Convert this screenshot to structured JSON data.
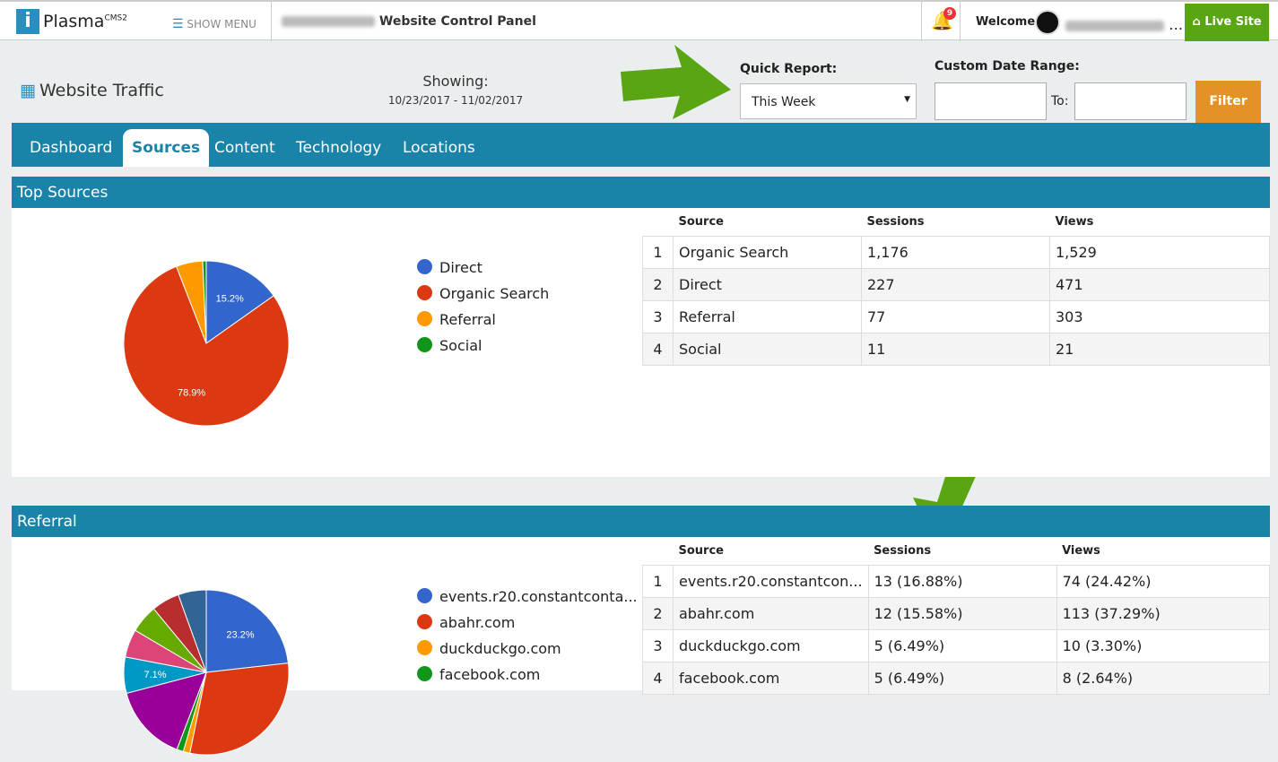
{
  "header": {
    "logo": "Plasma",
    "logo_sup": "CMS2",
    "menu_label": "SHOW MENU",
    "panel_title": "Website Control Panel",
    "notifications": "9",
    "welcome": "Welcome",
    "live_site": "Live Site"
  },
  "toolbar": {
    "page_title": "Website Traffic",
    "showing_label": "Showing:",
    "showing_range": "10/23/2017 - 11/02/2017",
    "quick_report_label": "Quick Report:",
    "quick_report_value": "This Week",
    "custom_range_label": "Custom Date Range:",
    "to_label": "To:",
    "filter": "Filter"
  },
  "tabs": [
    {
      "label": "Dashboard"
    },
    {
      "label": "Sources",
      "active": true
    },
    {
      "label": "Content"
    },
    {
      "label": "Technology"
    },
    {
      "label": "Locations"
    }
  ],
  "top_sources": {
    "title": "Top Sources",
    "columns": [
      "Source",
      "Sessions",
      "Views"
    ],
    "rows": [
      [
        "1",
        "Organic Search",
        "1,176",
        "1,529"
      ],
      [
        "2",
        "Direct",
        "227",
        "471"
      ],
      [
        "3",
        "Referral",
        "77",
        "303"
      ],
      [
        "4",
        "Social",
        "11",
        "21"
      ]
    ]
  },
  "referral": {
    "title": "Referral",
    "columns": [
      "Source",
      "Sessions",
      "Views"
    ],
    "rows": [
      [
        "1",
        "events.r20.constantcon...",
        "13 (16.88%)",
        "74 (24.42%)"
      ],
      [
        "2",
        "abahr.com",
        "12 (15.58%)",
        "113 (37.29%)"
      ],
      [
        "3",
        "duckduckgo.com",
        "5 (6.49%)",
        "10 (3.30%)"
      ],
      [
        "4",
        "facebook.com",
        "5 (6.49%)",
        "8 (2.64%)"
      ]
    ]
  },
  "chart_data": [
    {
      "type": "pie",
      "legend": [
        "Direct",
        "Organic Search",
        "Referral",
        "Social"
      ],
      "values": [
        15.2,
        78.9,
        5.2,
        0.7
      ],
      "labels": [
        "15.2%",
        "78.9%",
        "",
        ""
      ],
      "colors": [
        "#3366cc",
        "#dc3912",
        "#ff9900",
        "#109618"
      ],
      "legend_placement": "right"
    },
    {
      "type": "pie",
      "legend": [
        "events.r20.constantconta...",
        "abahr.com",
        "duckduckgo.com",
        "facebook.com"
      ],
      "values": [
        23.2,
        30,
        1.3,
        1.3,
        15.1,
        7.1,
        5.5,
        5.5,
        5.5,
        5.5
      ],
      "labels": [
        "23.2%",
        "",
        "",
        "",
        "",
        "7.1%",
        "",
        "",
        "",
        ""
      ],
      "colors": [
        "#3366cc",
        "#dc3912",
        "#ff9900",
        "#109618",
        "#990099",
        "#0099c6",
        "#dd4477",
        "#66aa00",
        "#b82e2e",
        "#316395"
      ],
      "legend_placement": "right"
    }
  ]
}
